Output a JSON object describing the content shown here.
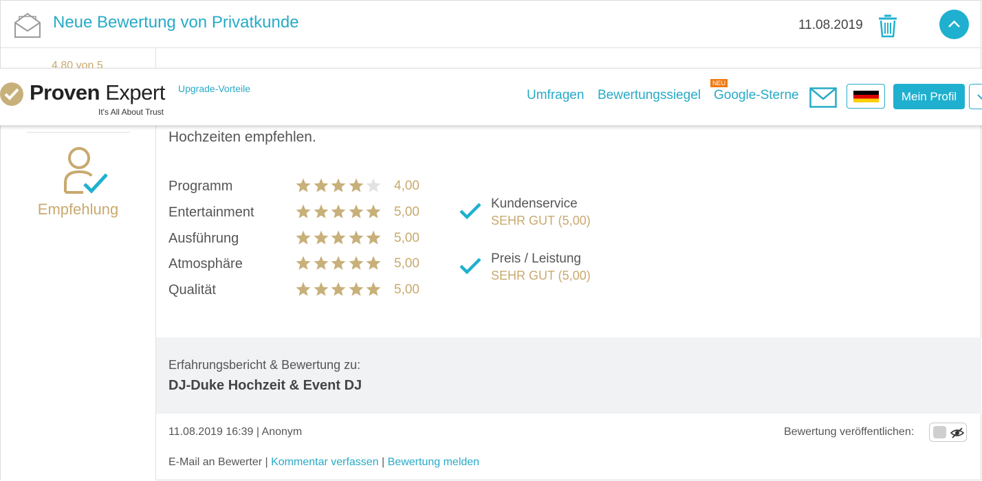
{
  "review": {
    "title": "Neue Bewertung von Privatkunde",
    "date": "11.08.2019"
  },
  "left": {
    "score": "4,80 von 5",
    "recommendation": "Empfehlung"
  },
  "body_text": "Hochzeiten empfehlen.",
  "ratings": [
    {
      "label": "Programm",
      "stars": 4,
      "value": "4,00"
    },
    {
      "label": "Entertainment",
      "stars": 5,
      "value": "5,00"
    },
    {
      "label": "Ausführung",
      "stars": 5,
      "value": "5,00"
    },
    {
      "label": "Atmosphäre",
      "stars": 5,
      "value": "5,00"
    },
    {
      "label": "Qualität",
      "stars": 5,
      "value": "5,00"
    }
  ],
  "criteria": [
    {
      "name": "Kundenservice",
      "value": "SEHR GUT (5,00)"
    },
    {
      "name": "Preis / Leistung",
      "value": "SEHR GUT (5,00)"
    }
  ],
  "info": {
    "caption": "Erfahrungsbericht & Bewertung zu:",
    "company": "DJ-Duke Hochzeit & Event DJ"
  },
  "meta": {
    "datetime_author": "11.08.2019 16:39 | Anonym",
    "publish_label": "Bewertung veröffentlichen:",
    "email_text": "E-Mail an Bewerter",
    "separator": " | ",
    "comment_link": "Kommentar verfassen",
    "report_link": "Bewertung melden"
  },
  "nav": {
    "logo_bold": "Proven",
    "logo_light": " Expert",
    "tagline": "It's All About Trust",
    "upgrade": "Upgrade-Vorteile",
    "links": [
      "Umfragen",
      "Bewertungssiegel",
      "Google-Sterne"
    ],
    "new_badge": "NEU",
    "profile_button": "Mein Profil"
  },
  "colors": {
    "accent": "#1fb0cf",
    "gold": "#c8a96e",
    "star_gold": "#c8b07a",
    "star_empty": "#e2e2e2",
    "new_badge": "#f07a12"
  },
  "icons": [
    "envelope-open-icon",
    "trash-icon",
    "chevron-up-icon",
    "recommend-user-icon",
    "check-icon",
    "star-icon",
    "eye-slash-icon",
    "logo-check-icon",
    "mail-icon",
    "germany-flag-icon",
    "chevron-down-icon"
  ]
}
